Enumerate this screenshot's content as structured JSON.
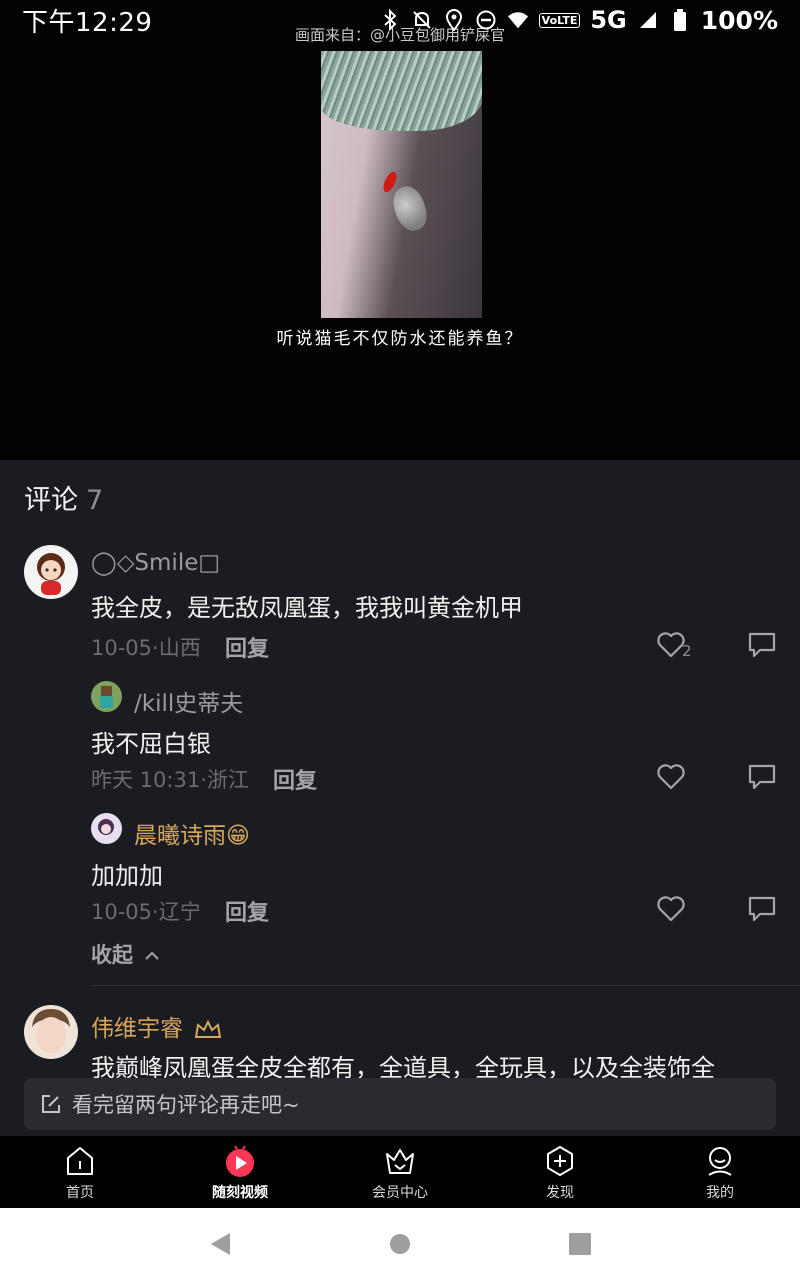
{
  "status_bar": {
    "time": "下午12:29",
    "network": "5G",
    "volte": "VoLTE",
    "battery": "100%"
  },
  "video": {
    "source": "画面来自：@小豆包御用铲屎官",
    "caption": "听说猫毛不仅防水还能养鱼？"
  },
  "comments": {
    "title": "评论",
    "count": "7",
    "items": [
      {
        "name": "◯◇Smile□",
        "text": "我全皮，是无敌凤凰蛋，我我叫黄金机甲",
        "meta": "10-05·山西",
        "reply": "回复",
        "likes": "2"
      },
      {
        "name": "/kill￼史蒂夫￼",
        "text": "我不屈白银",
        "meta": "昨天 10:31·浙江",
        "reply": "回复"
      },
      {
        "name": "晨曦诗雨😁",
        "text": "加加加",
        "meta": "10-05·辽宁",
        "reply": "回复"
      },
      {
        "name": "伟维宇睿",
        "text": "我巅峰凤凰蛋全皮全都有，全道具，全玩具，以及全装饰全"
      }
    ],
    "collapse_label": "收起",
    "input_placeholder": "看完留两句评论再走吧~"
  },
  "tabbar": {
    "items": [
      {
        "label": "首页",
        "icon": "home-icon"
      },
      {
        "label": "随刻视频",
        "icon": "play-icon"
      },
      {
        "label": "会员中心",
        "icon": "crown-icon"
      },
      {
        "label": "发现",
        "icon": "plus-hexagon-icon"
      },
      {
        "label": "我的",
        "icon": "profile-icon"
      }
    ]
  },
  "navbar": {
    "items": [
      "back-icon",
      "home-circle-icon",
      "recents-icon"
    ]
  }
}
